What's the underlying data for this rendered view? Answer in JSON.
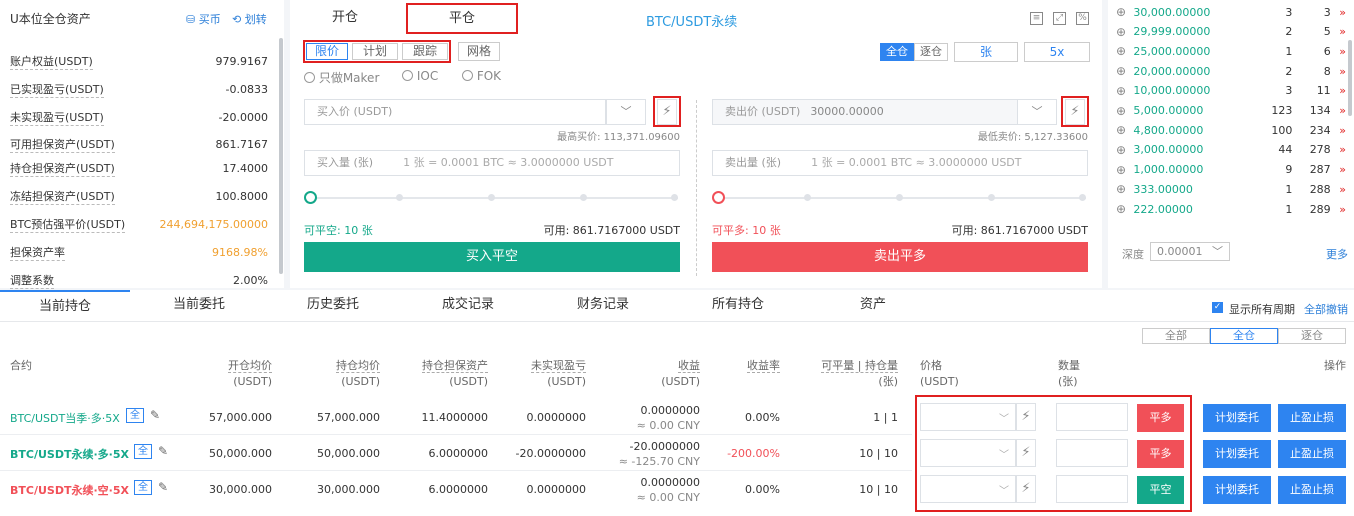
{
  "assets": {
    "title": "U本位全仓资产",
    "buy_label": "买币",
    "transfer_label": "划转",
    "rows": [
      {
        "label": "账户权益(USDT)",
        "value": "979.9167",
        "highlight": false
      },
      {
        "label": "已实现盈亏(USDT)",
        "value": "-0.0833",
        "highlight": false
      },
      {
        "label": "未实现盈亏(USDT)",
        "value": "-20.0000",
        "highlight": false
      },
      {
        "label": "可用担保资产(USDT)",
        "value": "861.7167",
        "highlight": false
      },
      {
        "label": "持仓担保资产(USDT)",
        "value": "17.4000",
        "highlight": false
      },
      {
        "label": "冻结担保资产(USDT)",
        "value": "100.8000",
        "highlight": false
      },
      {
        "label": "BTC预估强平价(USDT)",
        "value": "244,694,175.00000",
        "highlight": true
      },
      {
        "label": "担保资产率",
        "value": "9168.98%",
        "highlight": true
      },
      {
        "label": "调整系数",
        "value": "2.00%",
        "highlight": false
      }
    ]
  },
  "trade": {
    "tab_open": "开仓",
    "tab_close": "平仓",
    "title": "BTC/USDT永续",
    "order_types": [
      "限价",
      "计划",
      "跟踪",
      "网格"
    ],
    "margin_modes": [
      "全仓",
      "逐仓"
    ],
    "unit": "张",
    "leverage": "5x",
    "options": [
      "只做Maker",
      "IOC",
      "FOK"
    ],
    "buy": {
      "price_placeholder": "买入价 (USDT)",
      "price_hint": "最高买价: 113,371.09600",
      "qty_label": "买入量 (张)",
      "qty_hint": "1 张 = 0.0001 BTC ≈ 3.0000000 USDT",
      "closable": "可平空: 10 张",
      "available": "可用: 861.7167000 USDT",
      "button": "买入平空"
    },
    "sell": {
      "price_label": "卖出价 (USDT)",
      "price_value": "30000.00000",
      "price_hint": "最低卖价: 5,127.33600",
      "qty_label": "卖出量 (张)",
      "qty_hint": "1 张 = 0.0001 BTC ≈ 3.0000000 USDT",
      "closable": "可平多: 10 张",
      "available": "可用: 861.7167000 USDT",
      "button": "卖出平多"
    }
  },
  "orderbook": {
    "rows": [
      {
        "price": "30,000.00000",
        "qty": "3",
        "cum": "3"
      },
      {
        "price": "29,999.00000",
        "qty": "2",
        "cum": "5"
      },
      {
        "price": "25,000.00000",
        "qty": "1",
        "cum": "6"
      },
      {
        "price": "20,000.00000",
        "qty": "2",
        "cum": "8"
      },
      {
        "price": "10,000.00000",
        "qty": "3",
        "cum": "11"
      },
      {
        "price": "5,000.00000",
        "qty": "123",
        "cum": "134"
      },
      {
        "price": "4,800.00000",
        "qty": "100",
        "cum": "234"
      },
      {
        "price": "3,000.00000",
        "qty": "44",
        "cum": "278"
      },
      {
        "price": "1,000.00000",
        "qty": "9",
        "cum": "287"
      },
      {
        "price": "333.00000",
        "qty": "1",
        "cum": "288"
      },
      {
        "price": "222.00000",
        "qty": "1",
        "cum": "289"
      }
    ],
    "depth_label": "深度",
    "depth_value": "0.00001",
    "more": "更多"
  },
  "bottom": {
    "tabs": [
      "当前持仓",
      "当前委托",
      "历史委托",
      "成交记录",
      "财务记录",
      "所有持仓",
      "资产"
    ],
    "show_all": "显示所有周期",
    "cancel_all": "全部撤销",
    "filters": [
      "全部",
      "全仓",
      "逐仓"
    ],
    "headers": {
      "contract": "合约",
      "open_avg": "开仓均价",
      "open_avg_u": "(USDT)",
      "hold_avg": "持仓均价",
      "hold_avg_u": "(USDT)",
      "margin": "持仓担保资产",
      "margin_u": "(USDT)",
      "upnl": "未实现盈亏",
      "upnl_u": "(USDT)",
      "pnl": "收益",
      "pnl_u": "(USDT)",
      "rate": "收益率",
      "qty": "可平量 | 持仓量",
      "qty_u": "(张)",
      "price": "价格",
      "price_u": "(USDT)",
      "amount": "数量",
      "amount_u": "(张)",
      "action": "操作"
    },
    "positions": [
      {
        "name": "BTC/USDT当季·多·5X",
        "tag": "全",
        "open": "57,000.000",
        "hold": "57,000.000",
        "margin": "11.4000000",
        "upnl": "0.0000000",
        "pnl": "0.0000000",
        "pnl_cny": "≈ 0.00 CNY",
        "rate": "0.00%",
        "qty": "1 | 1",
        "close_btn": "平多",
        "plan_btn": "计划委托",
        "tp_btn": "止盈止损",
        "color": "#14a88a",
        "rate_color": "#333",
        "bold": false,
        "close_color": "#f15058"
      },
      {
        "name": "BTC/USDT永续·多·5X",
        "tag": "全",
        "open": "50,000.000",
        "hold": "50,000.000",
        "margin": "6.0000000",
        "upnl": "-20.0000000",
        "pnl": "-20.0000000",
        "pnl_cny": "≈ -125.70 CNY",
        "rate": "-200.00%",
        "qty": "10 | 10",
        "close_btn": "平多",
        "plan_btn": "计划委托",
        "tp_btn": "止盈止损",
        "color": "#14a88a",
        "rate_color": "#f15058",
        "bold": true,
        "close_color": "#f15058"
      },
      {
        "name": "BTC/USDT永续·空·5X",
        "tag": "全",
        "open": "30,000.000",
        "hold": "30,000.000",
        "margin": "6.0000000",
        "upnl": "0.0000000",
        "pnl": "0.0000000",
        "pnl_cny": "≈ 0.00 CNY",
        "rate": "0.00%",
        "qty": "10 | 10",
        "close_btn": "平空",
        "plan_btn": "计划委托",
        "tp_btn": "止盈止损",
        "color": "#f15058",
        "rate_color": "#333",
        "bold": true,
        "close_color": "#14a88a"
      }
    ]
  },
  "colors": {
    "green": "#14a88a",
    "red": "#f15058",
    "blue": "#2e84f0",
    "highlight": "#e02020"
  }
}
